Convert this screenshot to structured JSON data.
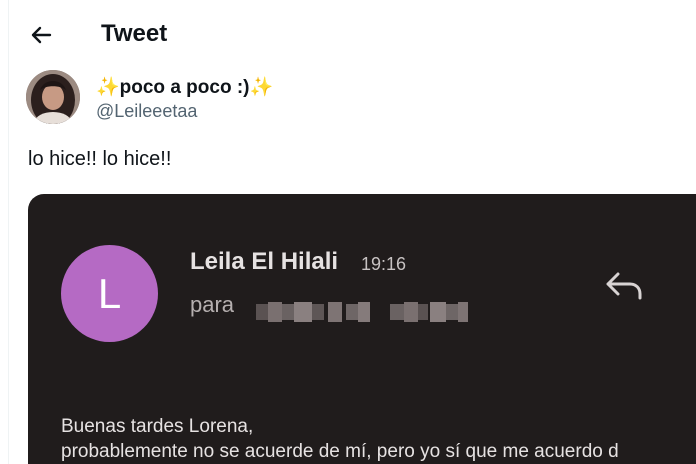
{
  "header": {
    "back_icon": "arrow-left-icon",
    "title": "Tweet"
  },
  "author": {
    "display_name": "✨poco a poco :)✨",
    "handle": "@Leileeetaa",
    "avatar_icon": "profile-photo"
  },
  "tweet": {
    "text": "lo hice!! lo hice!!"
  },
  "media": {
    "email": {
      "avatar_letter": "L",
      "avatar_color": "#b56ac4",
      "sender": "Leila El Hilali",
      "time": "19:16",
      "to_label": "para",
      "reply_icon": "reply-arrow-icon",
      "greeting": "Buenas tardes Lorena,",
      "body_line": "probablemente no se acuerde de mí, pero yo sí que me acuerdo d"
    }
  },
  "colors": {
    "text_primary": "#0f1419",
    "text_secondary": "#536471",
    "email_background": "#201c1c"
  }
}
